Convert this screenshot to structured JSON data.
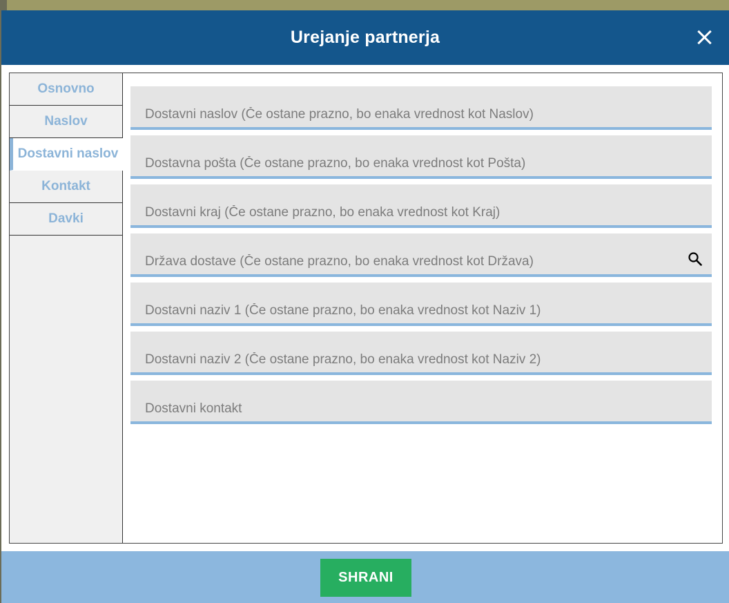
{
  "dialog": {
    "title": "Urejanje partnerja",
    "close_icon": "close-icon"
  },
  "tabs": [
    {
      "label": "Osnovno",
      "active": false
    },
    {
      "label": "Naslov",
      "active": false
    },
    {
      "label": "Dostavni naslov",
      "active": true
    },
    {
      "label": "Kontakt",
      "active": false
    },
    {
      "label": "Davki",
      "active": false
    }
  ],
  "fields": [
    {
      "placeholder": "Dostavni naslov (Če ostane prazno, bo enaka vrednost kot Naslov)",
      "value": ""
    },
    {
      "placeholder": "Dostavna pošta (Če ostane prazno, bo enaka vrednost kot Pošta)",
      "value": ""
    },
    {
      "placeholder": "Dostavni kraj (Če ostane prazno, bo enaka vrednost kot Kraj)",
      "value": ""
    },
    {
      "placeholder": "Država dostave (Če ostane prazno, bo enaka vrednost kot Država)",
      "value": "",
      "icon": "search-icon"
    },
    {
      "placeholder": "Dostavni naziv 1 (Če ostane prazno, bo enaka vrednost kot Naziv 1)",
      "value": ""
    },
    {
      "placeholder": "Dostavni naziv 2 (Če ostane prazno, bo enaka vrednost kot Naziv 2)",
      "value": ""
    },
    {
      "placeholder": "Dostavni kontakt",
      "value": ""
    }
  ],
  "footer": {
    "save_label": "SHRANI"
  },
  "colors": {
    "header": "#14568c",
    "accent": "#8cb4d8",
    "save": "#27ae60",
    "footer": "#8cb7de"
  }
}
